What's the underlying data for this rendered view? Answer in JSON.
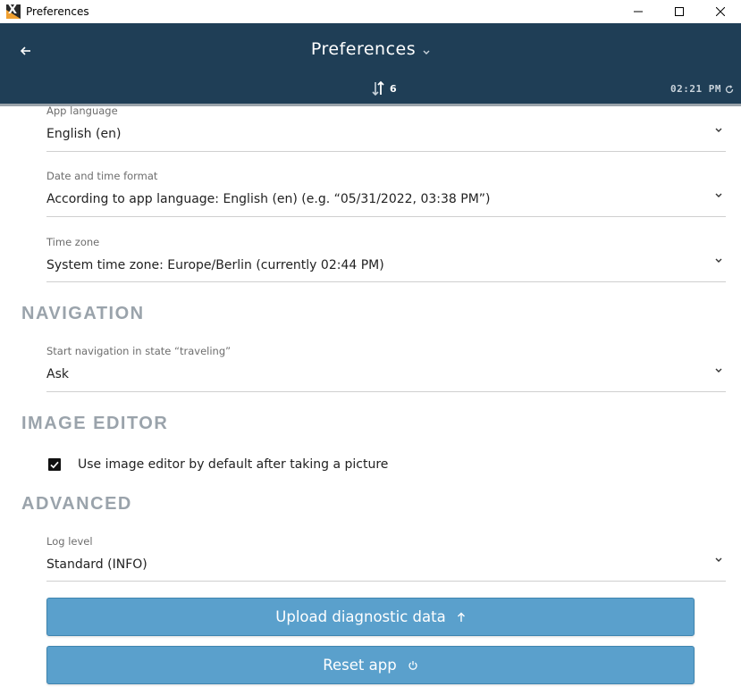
{
  "window": {
    "title": "Preferences"
  },
  "header": {
    "title": "Preferences",
    "sync_count": "6",
    "time": "02:21 PM"
  },
  "fields": {
    "app_language": {
      "label": "App language",
      "value": "English (en)"
    },
    "date_time_format": {
      "label": "Date and time format",
      "value": "According to app language: English (en) (e.g. “05/31/2022, 03:38 PM”)"
    },
    "time_zone": {
      "label": "Time zone",
      "value": "System time zone: Europe/Berlin (currently 02:44 PM)"
    },
    "start_navigation": {
      "label": "Start navigation in state “traveling”",
      "value": "Ask"
    },
    "log_level": {
      "label": "Log level",
      "value": "Standard (INFO)"
    }
  },
  "sections": {
    "navigation": "NAVIGATION",
    "image_editor": "IMAGE EDITOR",
    "advanced": "ADVANCED"
  },
  "image_editor": {
    "checkbox_label": "Use image editor by default after taking a picture",
    "checked": true
  },
  "buttons": {
    "upload": "Upload diagnostic data",
    "reset": "Reset app"
  },
  "colors": {
    "header_bg": "#1f3e56",
    "button_bg": "#5aa0cc",
    "section_heading": "#9aa3ab"
  }
}
